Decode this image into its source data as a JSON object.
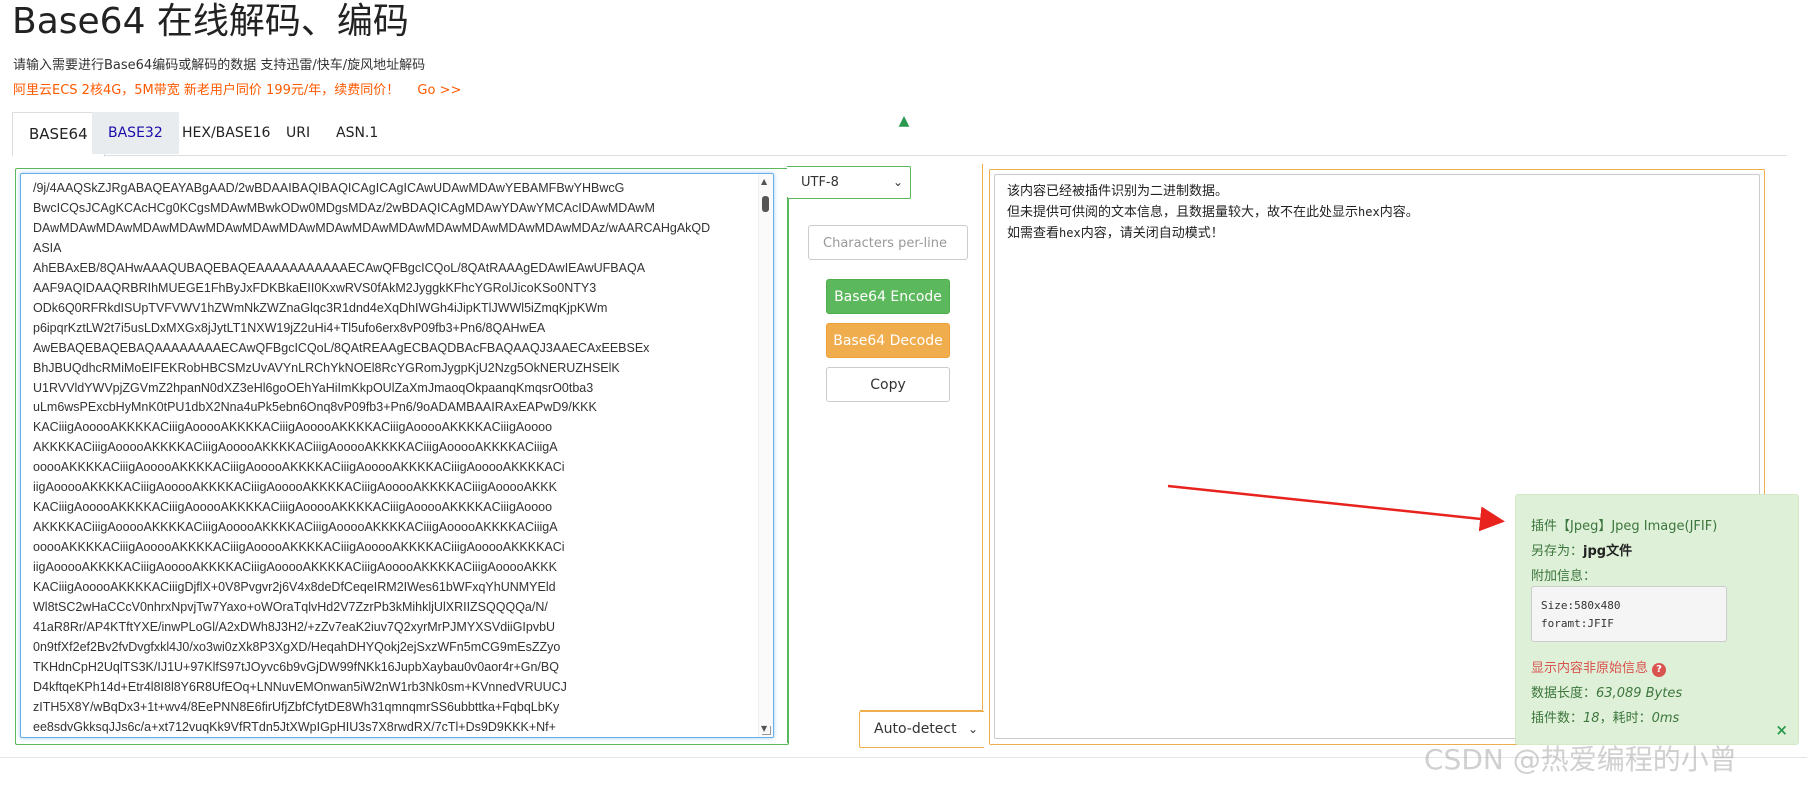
{
  "page": {
    "title": "Base64 在线解码、编码",
    "description": "请输入需要进行Base64编码或解码的数据 支持迅雷/快车/旋风地址解码",
    "promo": "阿里云ECS 2核4G，5M带宽 新老用户同价 199元/年，续费同价！",
    "promo_link": "Go >>"
  },
  "tabs": [
    {
      "label": "BASE64"
    },
    {
      "label": "BASE32"
    },
    {
      "label": "HEX/BASE16"
    },
    {
      "label": "URI"
    },
    {
      "label": "ASN.1"
    }
  ],
  "input": {
    "lines": [
      "/9j/4AAQSkZJRgABAQEAYABgAAD/2wBDAAIBAQIBAQICAgICAgICAwUDAwMDAwYEBAMFBwYHBwcG",
      "BwcICQsJCAgKCAcHCg0KCgsMDAwMBwkODw0MDgsMDAz/2wBDAQICAgMDAwYDAwYMCAcIDAwMDAwM",
      "DAwMDAwMDAwMDAwMDAwMDAwMDAwMDAwMDAwMDAwMDAwMDAwMDAwMDAwMDAwMDAz/wAARCAHgAkQD",
      "ASIA",
      "AhEBAxEB/8QAHwAAAQUBAQEBAQEAAAAAAAAAAAECAwQFBgcICQoL/8QAtRAAAgEDAwIEAwUFBAQA",
      "AAF9AQIDAAQRBRIhMUEGE1FhByJxFDKBkaEII0KxwRVS0fAkM2JyggkKFhcYGRolJicoKSo0NTY3",
      "ODk6Q0RFRkdISUpTVFVWV1hZWmNkZWZnaGlqc3R1dnd4eXqDhIWGh4iJipKTlJWWl5iZmqKjpKWm",
      "p6ipqrKztLW2t7i5usLDxMXGx8jJytLT1NXW19jZ2uHi4+Tl5ufo6erx8vP09fb3+Pn6/8QAHwEA",
      "AwEBAQEBAQEBAQAAAAAAAAECAwQFBgcICQoL/8QAtREAAgECBAQDBAcFBAQAAQJ3AAECAxEEBSEx",
      "BhJBUQdhcRMiMoEIFEKRobHBCSMzUvAVYnLRChYkNOEl8RcYGRomJygpKjU2Nzg5OkNERUZHSElK",
      "U1RVVldYWVpjZGVmZ2hpanN0dXZ3eHl6goOEhYaHiImKkpOUlZaXmJmaoqOkpaanqKmqsrO0tba3",
      "uLm6wsPExcbHyMnK0tPU1dbX2Nna4uPk5ebn6Onq8vP09fb3+Pn6/9oADAMBAAIRAxEAPwD9/KKK",
      "KACiiigAooooAKKKKACiiigAooooAKKKKACiiigAooooAKKKKACiiigAooooAKKKKACiiigAoooo",
      "AKKKKACiiigAooooAKKKKACiiigAooooAKKKKACiiigAooooAKKKKACiiigAooooAKKKKACiiigA",
      "ooooAKKKKACiiigAooooAKKKKACiiigAooooAKKKKACiiigAooooAKKKKACiiigAooooAKKKKACi",
      "iigAooooAKKKKACiiigAooooAKKKKACiiigAooooAKKKKACiiigAooooAKKKKACiiigAooooAKKK",
      "KACiiigAooooAKKKKACiiigAooooAKKKKACiiigAooooAKKKKACiiigAooooAKKKKACiiigAoooo",
      "AKKKKACiiigAooooAKKKKACiiigAooooAKKKKACiiigAooooAKKKKACiiigAooooAKKKKACiiigA",
      "ooooAKKKKACiiigAooooAKKKKACiiigAooooAKKKKACiiigAooooAKKKKACiiigAooooAKKKKACi",
      "iigAooooAKKKKACiiigAooooAKKKKACiiigAooooAKKKKACiiigAooooAKKKKACiiigAooooAKKK",
      "KACiiigAooooAKKKKACiiigDjflX+0V8Pvgvr2j6V4x8deDfCeqeIRM2IWes61bWFxqYhUNMYEld",
      "Wl8tSC2wHaCCcV0nhrxNpvjTw7Yaxo+oWOraTqlvHd2V7ZzrPb3kMihkljUlXRIIZSQQQQa/N/",
      "41aR8Rr/AP4KTftYXE/inwPLoGl/A2xDWh8J3H2/+zZv7eaK2iuv7Q2xyrMrPJMYXSVdiiGIpvbU",
      "0n9tfXf2ef2Bv2fvDvgfxkl4J0/xo3wi0zXk8P3XgXD/HeqahDHYQokj2ejSxzWFn5mCG9mEsZZyo",
      "TKHdnCpH2UqlTS3K/IJ1U+97KlfS97tJOyvc6b9vGjDW99fNKk16JupbXaybau0v0aor4r+Gn/BQ",
      "D4kftqeKPh14d+Etr4l8I8l8Y6R8UfEOq+LNNuvEMOnwan5iW2nW1rb3Nk0sm+KVnnedVRUUCJ",
      "zITH5X8Y/wBqDx3+1t+wv4/8EePNN8E6firUfjZbfCfytDE8Wh31qmnqmrSS6ubbttka+FqbqLbKy",
      "ee8sdvGkksqJJs6c/a+xt712vuqKk9VfRTdn5JtXWpIGpHIU3s7X8rwdRX/7cTl+Ds9D9KKK+Nf+"
    ]
  },
  "controls": {
    "charset": "UTF-8",
    "chars_per_line_placeholder": "Characters per-line",
    "encode_label": "Base64 Encode",
    "decode_label": "Base64 Decode",
    "copy_label": "Copy",
    "output_charset": "Auto-detect"
  },
  "output": {
    "line1": "该内容已经被插件识别为二进制数据。",
    "line2_a": "但未提供可供阅的文本信息，且数据量较大，故不在此处显示",
    "line2_code": "hex",
    "line2_b": "内容。",
    "line3_a": "如需查看",
    "line3_code": "hex",
    "line3_b": "内容，请关闭自动模式！"
  },
  "info": {
    "plugin": "插件【Jpeg】Jpeg Image(JFIF)",
    "save_as_label": "另存为：",
    "save_as_value": "jpg文件",
    "extra_label": "附加信息：",
    "size_line": "Size:580x480",
    "format_line": "foramt:JFIF",
    "warning": "显示内容非原始信息",
    "warning_icon": "?",
    "length_label": "数据长度：",
    "length_value": "63,089 Bytes",
    "plugin_count_label": "插件数：",
    "plugin_count_value": "18",
    "time_label": "，耗时：",
    "time_value": "0ms",
    "close": "×"
  },
  "watermark": "CSDN @热爱编程的小曾",
  "colors": {
    "green": "#5cb85c",
    "orange": "#f0ad4e",
    "promo": "#ff5a00",
    "arrow": "#e8231e",
    "info_bg": "#dff0d8"
  }
}
